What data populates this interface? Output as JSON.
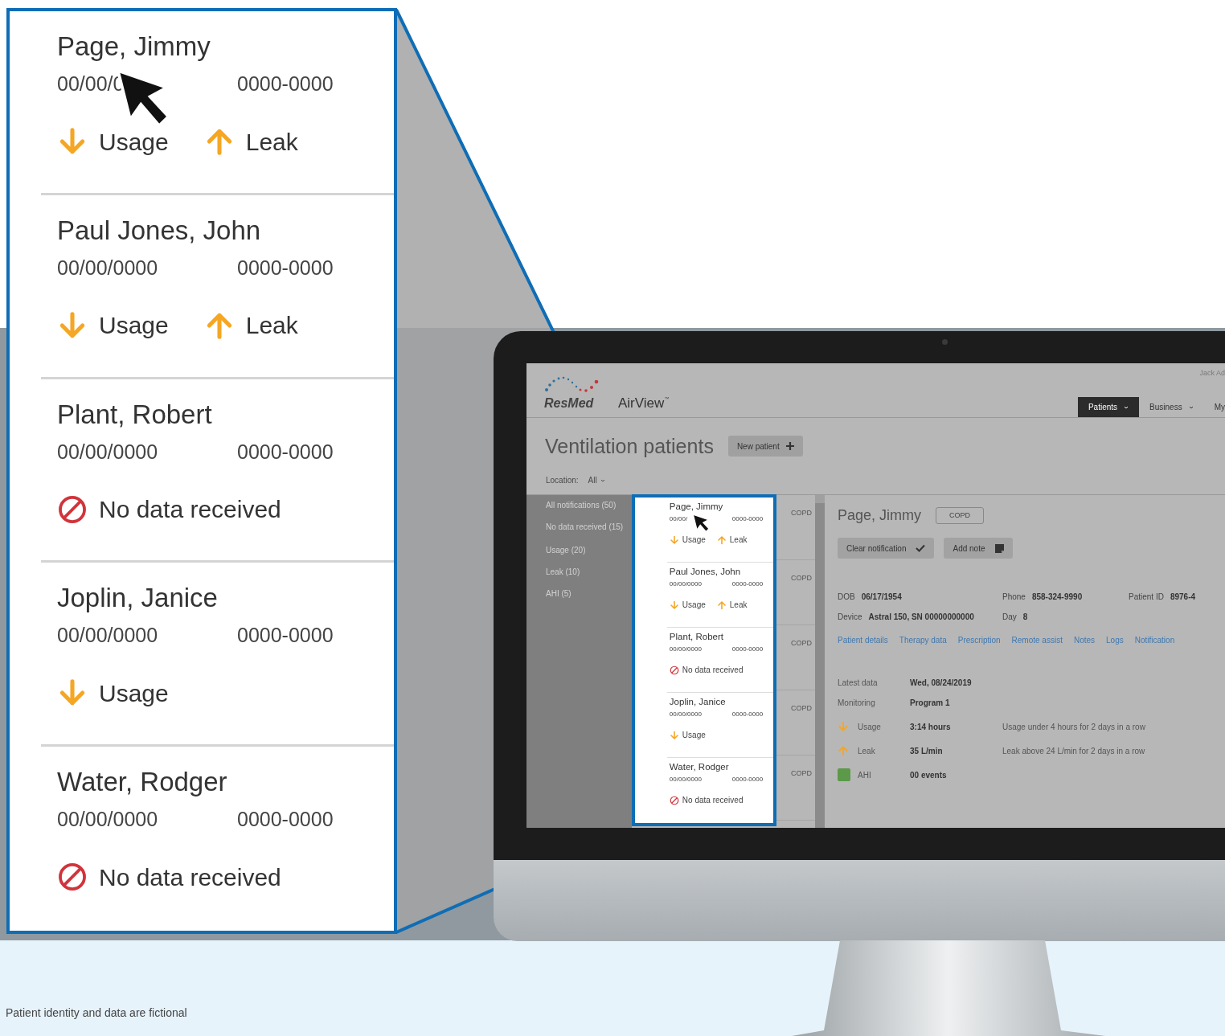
{
  "callout": {
    "patients": [
      {
        "name": "Page, Jimmy",
        "dob": "00/00/0",
        "phone": "0000-0000",
        "cursor": true,
        "alerts": [
          {
            "kind": "down",
            "label": "Usage"
          },
          {
            "kind": "up",
            "label": "Leak"
          }
        ]
      },
      {
        "name": "Paul Jones, John",
        "dob": "00/00/0000",
        "phone": "0000-0000",
        "cursor": false,
        "alerts": [
          {
            "kind": "down",
            "label": "Usage"
          },
          {
            "kind": "up",
            "label": "Leak"
          }
        ]
      },
      {
        "name": "Plant, Robert",
        "dob": "00/00/0000",
        "phone": "0000-0000",
        "cursor": false,
        "alerts": [
          {
            "kind": "none",
            "label": "No data received"
          }
        ]
      },
      {
        "name": "Joplin, Janice",
        "dob": "00/00/0000",
        "phone": "0000-0000",
        "cursor": false,
        "alerts": [
          {
            "kind": "down",
            "label": "Usage"
          }
        ]
      },
      {
        "name": "Water, Rodger",
        "dob": "00/00/0000",
        "phone": "0000-0000",
        "cursor": false,
        "alerts": [
          {
            "kind": "none",
            "label": "No data received"
          }
        ]
      }
    ]
  },
  "screen": {
    "header": {
      "user": "Jack Ad",
      "brand": "ResMed",
      "product": "AirView",
      "product_mark": "™",
      "nav": [
        {
          "label": "Patients",
          "selected": true
        },
        {
          "label": "Business",
          "selected": false
        },
        {
          "label": "My",
          "selected": false
        }
      ]
    },
    "title": "Ventilation patients",
    "new_button": "New patient",
    "location": {
      "label": "Location:",
      "value": "All"
    },
    "filters": [
      [
        "All notifications (50)",
        "No data received (15)"
      ],
      [
        "Usage (20)",
        "Leak (10)",
        "AHI (5)"
      ]
    ],
    "patients": [
      {
        "name": "Page, Jimmy",
        "dob": "00/00/",
        "phone": "0000-0000",
        "condition": "COPD",
        "cursor": true,
        "alerts": [
          {
            "kind": "down",
            "label": "Usage"
          },
          {
            "kind": "up",
            "label": "Leak"
          }
        ]
      },
      {
        "name": "Paul Jones, John",
        "dob": "00/00/0000",
        "phone": "0000-0000",
        "condition": "COPD",
        "cursor": false,
        "alerts": [
          {
            "kind": "down",
            "label": "Usage"
          },
          {
            "kind": "up",
            "label": "Leak"
          }
        ]
      },
      {
        "name": "Plant, Robert",
        "dob": "00/00/0000",
        "phone": "0000-0000",
        "condition": "COPD",
        "cursor": false,
        "alerts": [
          {
            "kind": "none",
            "label": "No data received"
          }
        ]
      },
      {
        "name": "Joplin, Janice",
        "dob": "00/00/0000",
        "phone": "0000-0000",
        "condition": "COPD",
        "cursor": false,
        "alerts": [
          {
            "kind": "down",
            "label": "Usage"
          }
        ]
      },
      {
        "name": "Water, Rodger",
        "dob": "00/00/0000",
        "phone": "0000-0000",
        "condition": "COPD",
        "cursor": false,
        "alerts": [
          {
            "kind": "none",
            "label": "No data received"
          }
        ]
      }
    ],
    "detail": {
      "name": "Page, Jimmy",
      "condition": "COPD",
      "buttons": [
        {
          "kind": "check",
          "label": "Clear notification"
        },
        {
          "kind": "note",
          "label": "Add note"
        }
      ],
      "info": [
        [
          {
            "label": "DOB",
            "value": "06/17/1954"
          },
          {
            "label": "Phone",
            "value": "858-324-9990"
          },
          {
            "label": "Patient ID",
            "value": "8976-4"
          }
        ],
        [
          {
            "label": "Device",
            "value": "Astral 150, SN 00000000000"
          },
          {
            "label": "Day",
            "value": "8"
          }
        ]
      ],
      "tabs": [
        "Patient details",
        "Therapy data",
        "Prescription",
        "Remote assist",
        "Notes",
        "Logs",
        "Notification"
      ],
      "summary": [
        {
          "label": "Latest data",
          "value": "Wed, 08/24/2019"
        },
        {
          "label": "Monitoring",
          "value": "Program 1"
        }
      ],
      "metrics": [
        {
          "kind": "down",
          "label": "Usage",
          "value": "3:14 hours",
          "note": "Usage under 4 hours for 2 days in a row"
        },
        {
          "kind": "up",
          "label": "Leak",
          "value": "35 L/min",
          "note": "Leak above 24 L/min for 2 days in a row"
        },
        {
          "kind": "square",
          "color": "#5c9a4a",
          "label": "AHI",
          "value": "00 events"
        }
      ]
    }
  },
  "footnote": "Patient identity and data are fictional"
}
